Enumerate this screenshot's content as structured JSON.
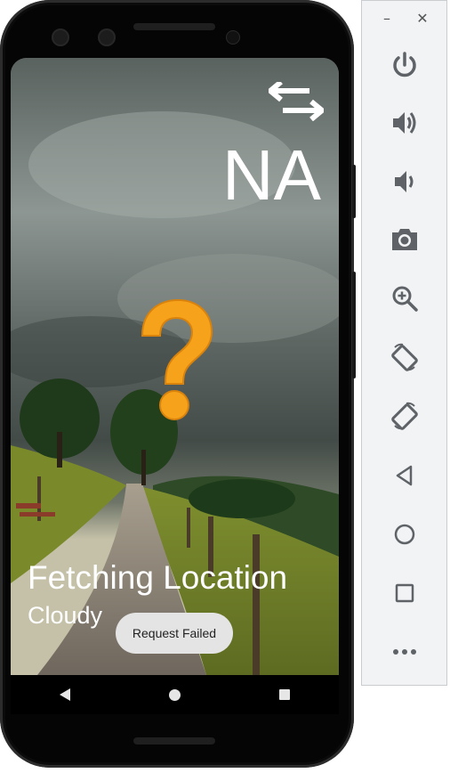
{
  "app": {
    "temperature": "NA",
    "location": "Fetching Location",
    "condition": "Cloudy",
    "toast": "Request Failed"
  },
  "emulator": {
    "window_controls": {
      "minimize": "–",
      "close": "✕"
    },
    "tools": [
      "power-icon",
      "volume-up-icon",
      "volume-down-icon",
      "camera-icon",
      "zoom-in-icon",
      "rotate-left-icon",
      "rotate-right-icon",
      "back-icon",
      "home-icon",
      "overview-icon",
      "more-icon"
    ]
  },
  "colors": {
    "icon_gray": "#5f6368",
    "question_mark": "#f7a21b",
    "toast_bg": "#e4e4e4"
  }
}
